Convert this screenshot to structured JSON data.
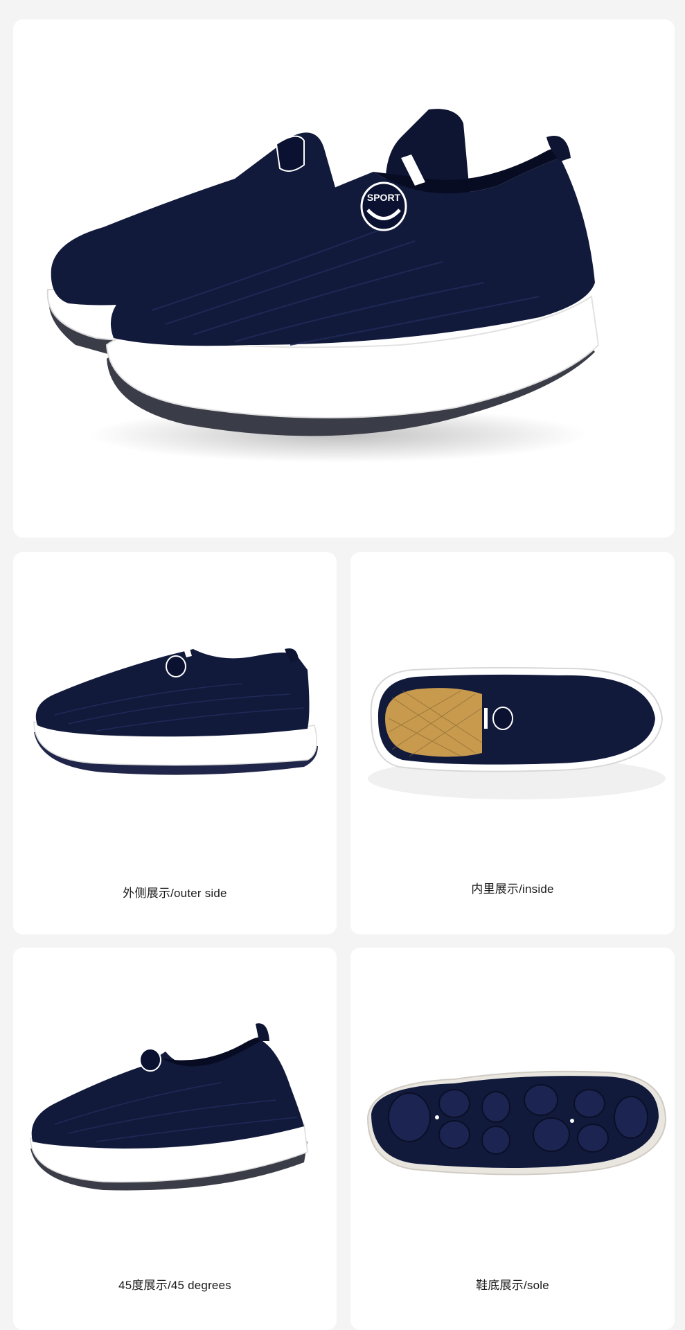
{
  "colors": {
    "background": "#f4f4f4",
    "card": "#ffffff",
    "shoe_upper": "#121a3c",
    "sole": "#ffffff",
    "outsole": "#3a3d48",
    "insole": "#c79a4e"
  },
  "hero": {
    "logo_text": "SPORT"
  },
  "views": [
    {
      "caption": "外侧展示/outer side"
    },
    {
      "caption": "内里展示/inside"
    },
    {
      "caption": "45度展示/45 degrees"
    },
    {
      "caption": "鞋底展示/sole"
    }
  ]
}
